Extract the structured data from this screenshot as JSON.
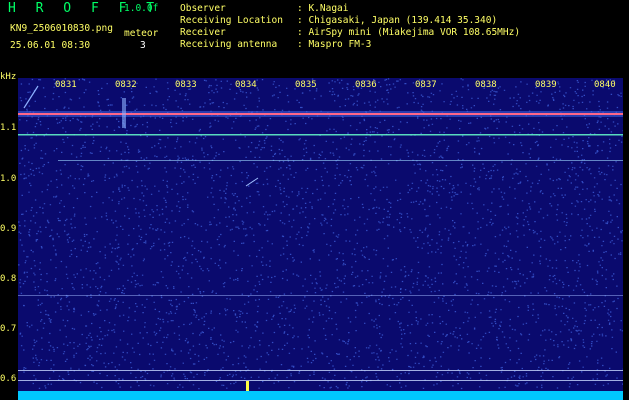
{
  "header": {
    "title": "H R O F F T",
    "version": "1.0.0f",
    "filename": "KN9_2506010830.png",
    "datetime": "25.06.01 08:30",
    "meteor_label": "meteor",
    "meteor_count": "3"
  },
  "info": [
    {
      "label": "Observer",
      "value": ": K.Nagai"
    },
    {
      "label": "Receiving Location",
      "value": ": Chigasaki, Japan (139.414 35.340)"
    },
    {
      "label": "Receiver",
      "value": ": AirSpy mini (Miakejima VOR 108.65MHz)"
    },
    {
      "label": "Receiving antenna",
      "value": ": Maspro FM-3"
    }
  ],
  "axis": {
    "y_unit": "kHz",
    "y_ticks": [
      "1.1",
      "1.0",
      "0.9",
      "0.8",
      "0.7",
      "0.6"
    ],
    "x_ticks": [
      "0831",
      "0832",
      "0833",
      "0834",
      "0835",
      "0836",
      "0837",
      "0838",
      "0839",
      "0840"
    ]
  },
  "colors": {
    "background": "#0a0a6e",
    "noise": "#3c5cd8",
    "carrier": "#ff6688",
    "trace": "#66ffcc",
    "bottom_band": "#00c8ff"
  }
}
